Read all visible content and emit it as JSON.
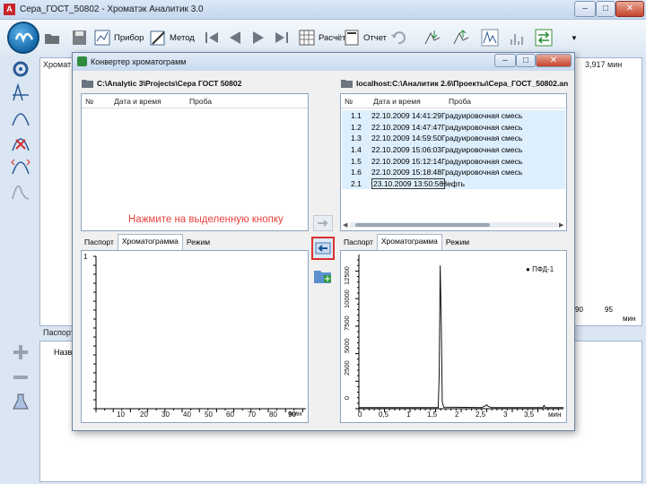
{
  "window": {
    "title": "Сера_ГОСТ_50802 - Хроматэк Аналитик 3.0",
    "controls": [
      "–",
      "□",
      "✕"
    ]
  },
  "toolbar": {
    "device_label": "Прибор",
    "method_label": "Метод",
    "calc_label": "Расчёт",
    "report_label": "Отчет"
  },
  "background": {
    "tab_label": "Хромат",
    "status": "3,917 мин",
    "x_ticks": [
      "90",
      "95"
    ],
    "x_unit": "мин",
    "lower_tab": "Паспорт",
    "lower_col": "Назв"
  },
  "dialog": {
    "title": "Конвертер хроматограмм",
    "controls": [
      "–",
      "□",
      "✕"
    ],
    "hint": "Нажмите на выделенную кнопку",
    "left": {
      "path": "C:\\Analytic 3\\Projects\\Сера ГОСТ 50802",
      "columns": [
        "№",
        "Дата и время",
        "Проба"
      ],
      "tabs": [
        "Паспорт",
        "Хроматограмма",
        "Режим"
      ],
      "active_tab": "Хроматограмма",
      "x_ticks": [
        "10",
        "20",
        "30",
        "40",
        "50",
        "60",
        "70",
        "80",
        "90"
      ],
      "x_unit": "мин",
      "y_tick": "1"
    },
    "right": {
      "path": "localhost:C:\\Аналитик 2.6\\Проекты\\Сера_ГОСТ_50802.an",
      "columns": [
        "№",
        "Дата и время",
        "Проба"
      ],
      "rows": [
        {
          "num": "1.1",
          "datetime": "22.10.2009 14:41:29",
          "sample": "Градуировочная смесь"
        },
        {
          "num": "1.2",
          "datetime": "22.10.2009 14:47:47",
          "sample": "Градуировочная смесь"
        },
        {
          "num": "1.3",
          "datetime": "22.10.2009 14:59:50",
          "sample": "Градуировочная смесь"
        },
        {
          "num": "1.4",
          "datetime": "22.10.2009 15:06:03",
          "sample": "Градуировочная смесь"
        },
        {
          "num": "1.5",
          "datetime": "22.10.2009 15:12:14",
          "sample": "Градуировочная смесь"
        },
        {
          "num": "1.6",
          "datetime": "22.10.2009 15:18:48",
          "sample": "Градуировочная смесь"
        },
        {
          "num": "2.1",
          "datetime": "23.10.2009 13:50:56",
          "sample": "Нефть"
        }
      ],
      "tabs": [
        "Паспорт",
        "Хроматограмма",
        "Режим"
      ],
      "active_tab": "Хроматограмма",
      "legend": "ПФД-1",
      "y_ticks": [
        "12500",
        "10000",
        "7500",
        "5000",
        "2500",
        "0"
      ],
      "x_ticks": [
        "0",
        "0,5",
        "1",
        "1,5",
        "2",
        "2,5",
        "3",
        "3,5"
      ],
      "x_unit": "мин"
    }
  },
  "chart_data": {
    "type": "line",
    "title": "",
    "xlabel": "мин",
    "ylabel": "",
    "xlim": [
      0,
      4
    ],
    "ylim": [
      0,
      14000
    ],
    "series": [
      {
        "name": "ПФД-1",
        "x": [
          0,
          1.55,
          1.57,
          1.59,
          1.61,
          1.63,
          1.66,
          2.4,
          2.47,
          2.5,
          2.53,
          2.6,
          3.6,
          3.62,
          3.64,
          4
        ],
        "y": [
          100,
          100,
          3000,
          13000,
          8000,
          600,
          150,
          100,
          250,
          350,
          200,
          100,
          100,
          300,
          100,
          100
        ]
      }
    ]
  },
  "colors": {
    "hint": "#e8413d",
    "selection": "#ddeefc",
    "highlight_border": "#d9322d"
  }
}
